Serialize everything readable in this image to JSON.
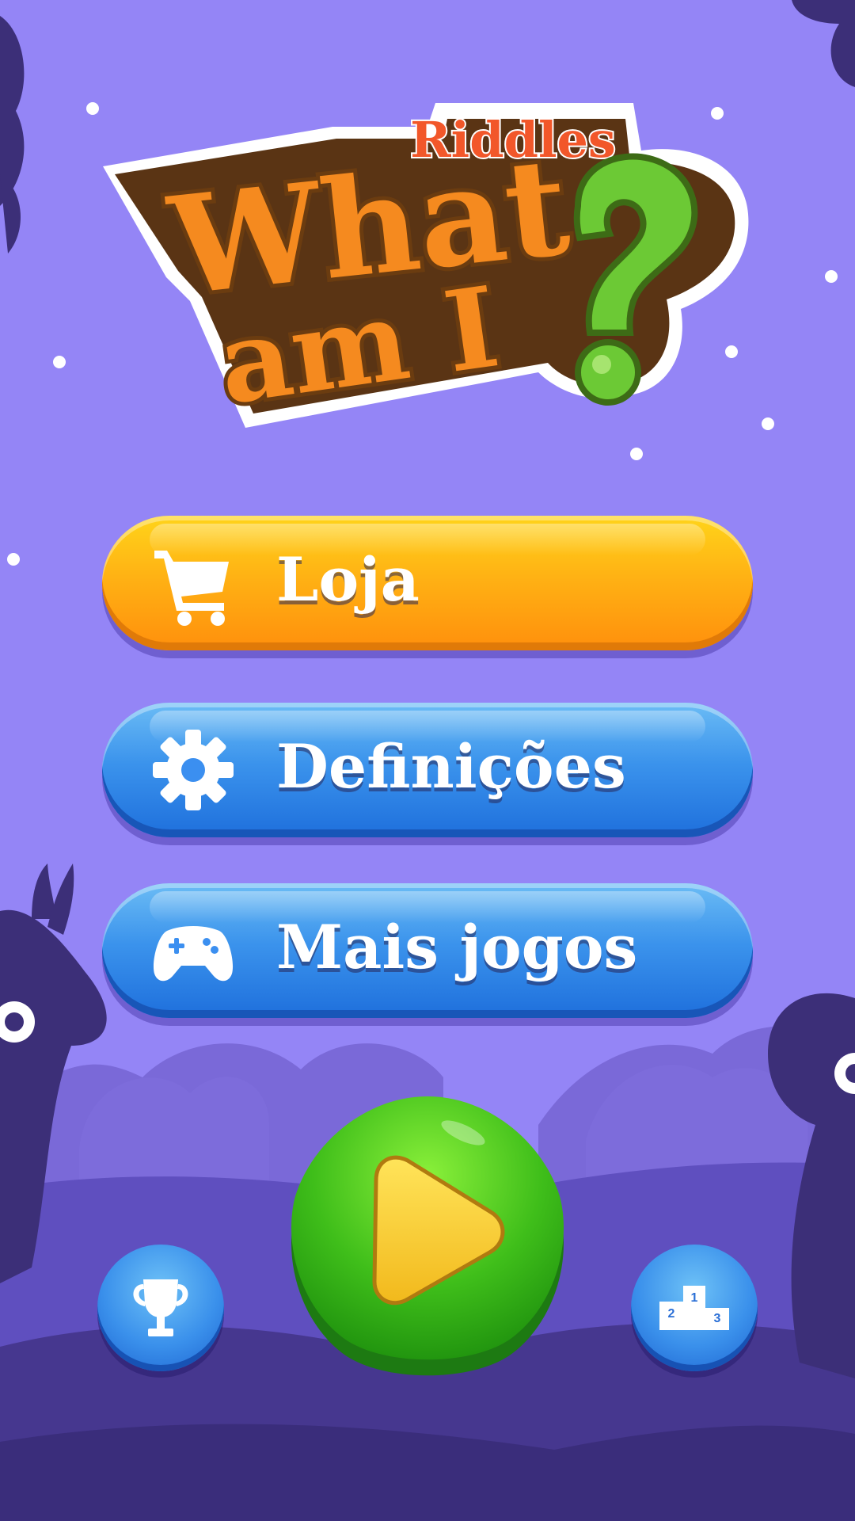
{
  "logo": {
    "riddles": "Riddles",
    "line1": "What",
    "line2": "am I"
  },
  "menu": {
    "shop_label": "Loja",
    "settings_label": "Definições",
    "more_games_label": "Mais jogos"
  },
  "icons": {
    "shop": "shopping-cart-icon",
    "settings": "gear-icon",
    "more_games": "gamepad-icon",
    "play": "play-icon",
    "trophy": "trophy-icon",
    "leaderboard": "podium-icon"
  },
  "podium": {
    "first": "1",
    "second": "2",
    "third": "3"
  },
  "colors": {
    "background": "#9485f6",
    "shop_button": "#ffa912",
    "blue_button": "#3b8ff0",
    "play_button": "#4cc81c",
    "play_triangle": "#f5d42a",
    "logo_orange": "#f38a1e",
    "logo_green": "#6cc935",
    "silhouette": "#3c2f78"
  }
}
